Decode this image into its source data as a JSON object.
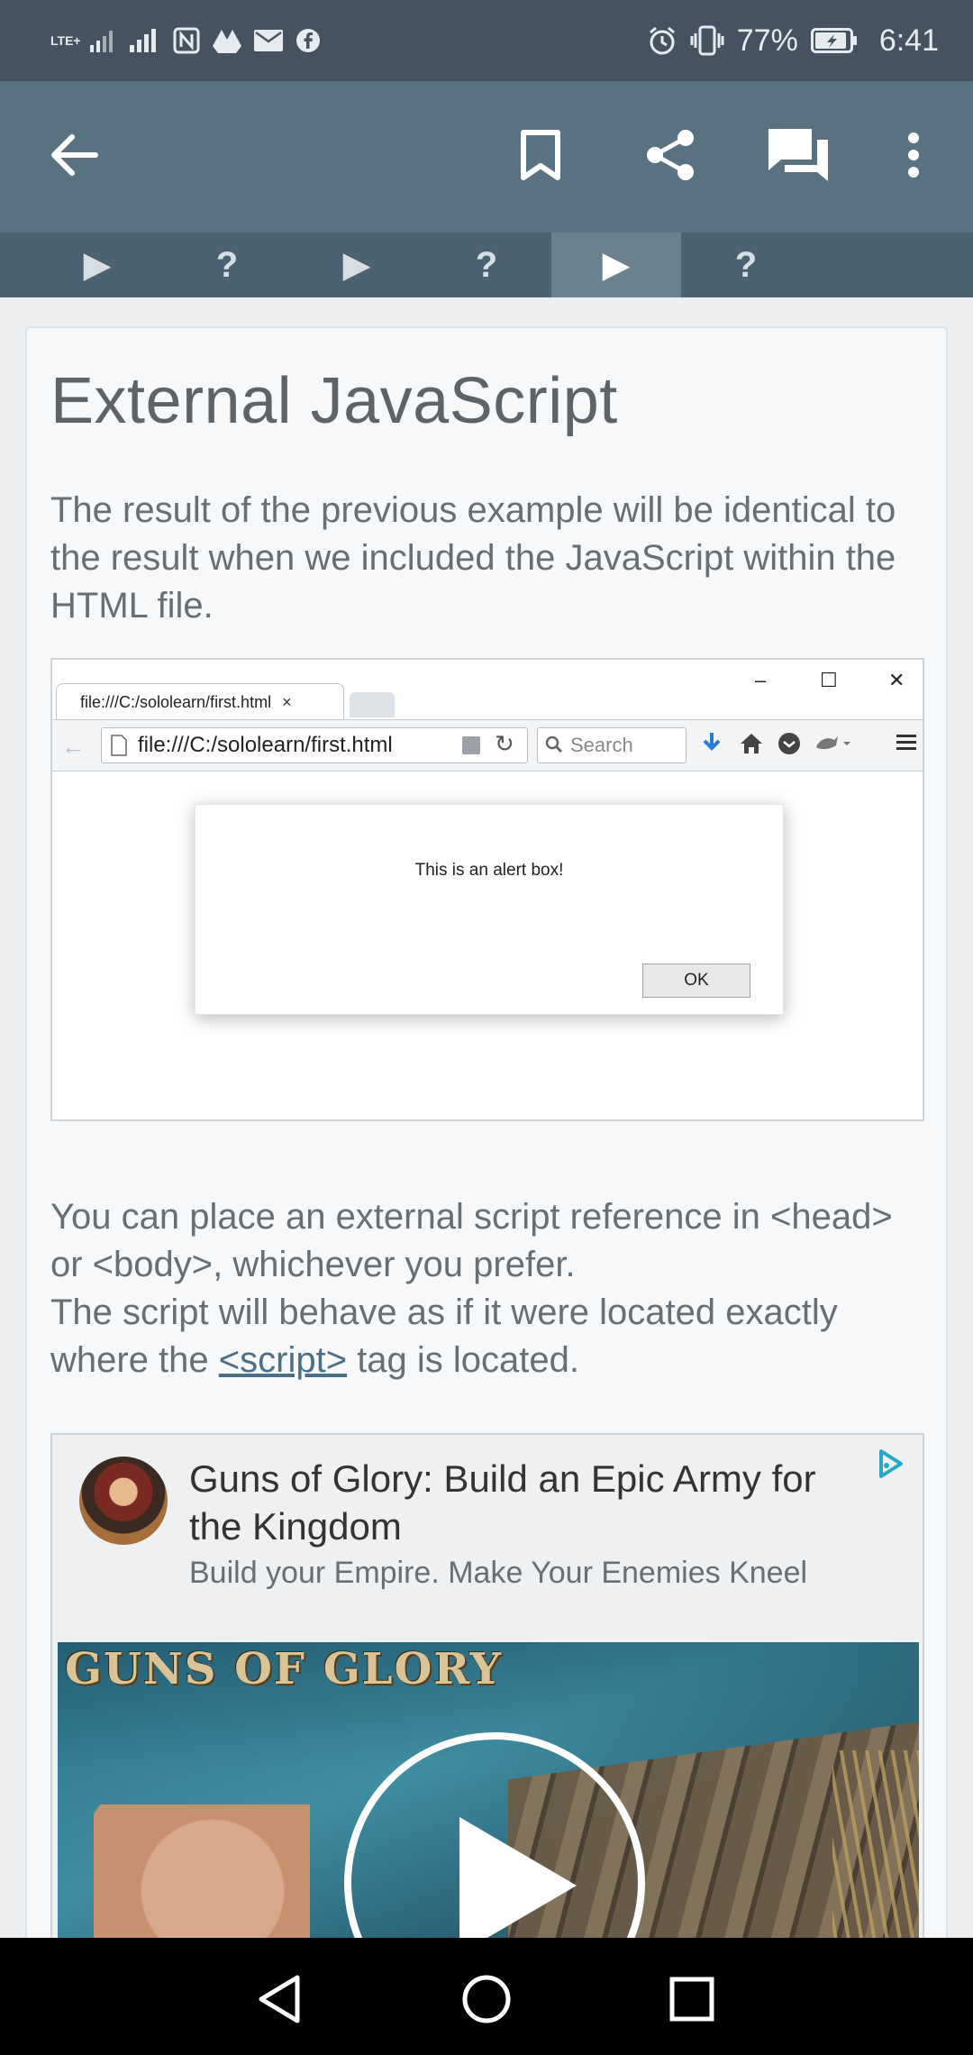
{
  "status_bar": {
    "network_label": "LTE+",
    "battery": "77%",
    "time": "6:41"
  },
  "app_bar": {
    "icons": [
      "back-arrow-icon",
      "bookmark-icon",
      "share-icon",
      "comments-icon",
      "more-vert-icon"
    ]
  },
  "steps": [
    {
      "label": "▶",
      "active": false
    },
    {
      "label": "?",
      "active": false
    },
    {
      "label": "▶",
      "active": false
    },
    {
      "label": "?",
      "active": false
    },
    {
      "label": "▶",
      "active": true
    },
    {
      "label": "?",
      "active": false
    }
  ],
  "lesson": {
    "title": "External JavaScript",
    "para1": "The result of the previous example will be identical to the result when we included the JavaScript within the HTML file.",
    "para2_line1": "You can place an external script reference in <head> or <body>, whichever you prefer.",
    "para2_line2_before": "The script will behave as if it were located exactly where the ",
    "para2_link": "<script>",
    "para2_line2_after": " tag is located."
  },
  "browser_example": {
    "tab_title": "file:///C:/sololearn/first.html",
    "tab_close": "×",
    "win_minimize": "–",
    "win_maximize": "☐",
    "win_close": "✕",
    "url": "file:///C:/sololearn/first.html",
    "search_placeholder": "Search",
    "alert_message": "This is an alert box!",
    "alert_ok": "OK"
  },
  "ad": {
    "title": "Guns of Glory: Build an Epic Army for the Kingdom",
    "subtitle": "Build your Empire. Make Your Enemies Kneel",
    "image_logo_text": "GUNS OF GLORY",
    "accent_color": "#26a7c9"
  },
  "colors": {
    "status_bar": "#44535f",
    "app_bar": "#597180",
    "steps_bar": "#4c6271",
    "step_active": "#6c818e"
  }
}
